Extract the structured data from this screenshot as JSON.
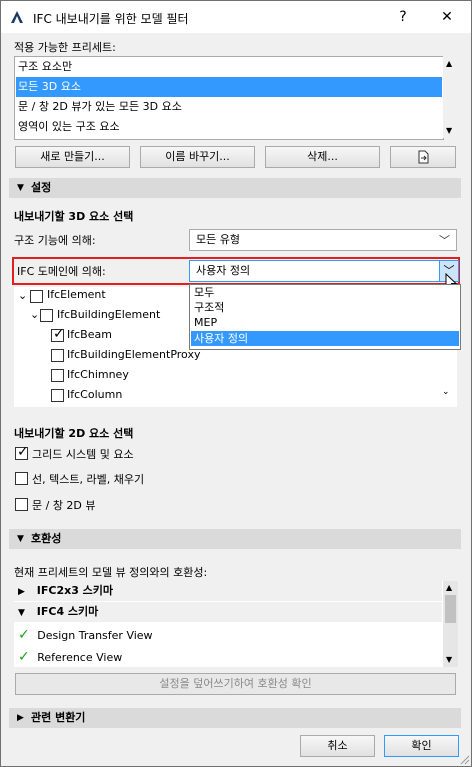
{
  "window": {
    "title": "IFC 내보내기를 위한 모델 필터",
    "help": "?",
    "close": "✕"
  },
  "presets": {
    "label": "적용 가능한 프리세트:",
    "items": [
      "구조 요소만",
      "모든 3D 요소",
      "문 / 창 2D 뷰가 있는 모든 3D 요소",
      "영역이 있는 구조 요소"
    ],
    "selected_index": 1,
    "buttons": {
      "new": "새로 만들기...",
      "rename": "이름 바꾸기...",
      "delete": "삭제..."
    }
  },
  "settings": {
    "header": "설정",
    "export3d_title": "내보내기할 3D 요소 선택",
    "structural_label": "구조 기능에 의해:",
    "structural_value": "모든 유형",
    "ifc_domain_label": "IFC 도메인에 의해:",
    "ifc_domain_value": "사용자 정의",
    "ifc_domain_options": [
      "모두",
      "구조적",
      "MEP",
      "사용자 정의"
    ],
    "tree": [
      {
        "label": "IfcElement",
        "checked": false
      },
      {
        "label": "IfcBuildingElement",
        "checked": false
      },
      {
        "label": "IfcBeam",
        "checked": true
      },
      {
        "label": "IfcBuildingElementProxy",
        "checked": false
      },
      {
        "label": "IfcChimney",
        "checked": false
      },
      {
        "label": "IfcColumn",
        "checked": false
      }
    ],
    "export2d_title": "내보내기할 2D 요소 선택",
    "options2d": [
      {
        "label": "그리드 시스템 및 요소",
        "checked": true
      },
      {
        "label": "선, 텍스트, 라벨, 채우기",
        "checked": false
      },
      {
        "label": "문 / 창 2D 뷰",
        "checked": false
      }
    ]
  },
  "compat": {
    "header": "호환성",
    "desc": "현재 프리세트의 모델 뷰 정의와의 호환성:",
    "schemas": [
      {
        "label": "IFC2x3 스키마",
        "expanded": false
      },
      {
        "label": "IFC4 스키마",
        "expanded": true
      }
    ],
    "views": [
      "Design Transfer View",
      "Reference View"
    ],
    "button": "설정을 덮어쓰기하여 호환성 확인"
  },
  "related": {
    "header": "관련 변환기"
  },
  "footer": {
    "cancel": "취소",
    "ok": "확인"
  },
  "colors": {
    "selection": "#3399ff",
    "highlight_border": "#e02020",
    "check_green": "#1aa11a"
  }
}
